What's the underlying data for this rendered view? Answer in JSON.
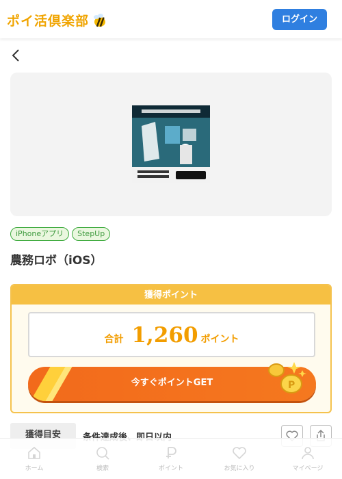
{
  "header": {
    "logo_text": "ポイ活倶楽部",
    "login_label": "ログイン"
  },
  "tags": [
    "iPhoneアプリ",
    "StepUp"
  ],
  "title": "農務ロボ（iOS）",
  "points": {
    "header": "獲得ポイント",
    "total_label": "合計",
    "total_value": "1,260",
    "total_unit": "ポイント",
    "cta_label": "今すぐポイントGET"
  },
  "guide": {
    "label": "獲得目安",
    "text": "条件達成後、即日以内"
  },
  "bottom_nav": [
    {
      "label": "ホーム",
      "icon": "home-icon"
    },
    {
      "label": "検索",
      "icon": "search-icon"
    },
    {
      "label": "ポイント",
      "icon": "point-icon"
    },
    {
      "label": "お気に入り",
      "icon": "heart-icon"
    },
    {
      "label": "マイページ",
      "icon": "user-icon"
    }
  ],
  "colors": {
    "brand": "#f0a400",
    "login": "#2f7fe0",
    "cta": "#f26a1b",
    "tag_green": "#3daa3d"
  }
}
